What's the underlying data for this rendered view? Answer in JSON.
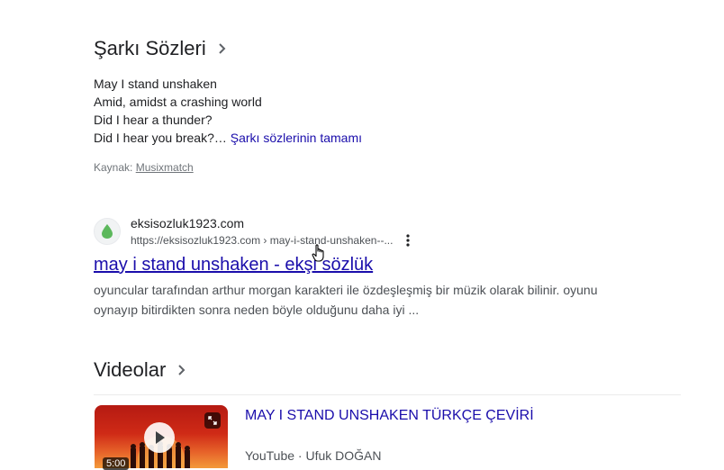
{
  "lyrics_section": {
    "title": "Şarkı Sözleri",
    "lines": [
      "May I stand unshaken",
      "Amid, amidst a crashing world",
      "Did I hear a thunder?",
      "Did I hear you break?…"
    ],
    "full_lyrics_link": "Şarkı sözlerinin tamamı",
    "source_label": "Kaynak:",
    "source_name": "Musixmatch"
  },
  "result": {
    "site_name": "eksisozluk1923.com",
    "url": "https://eksisozluk1923.com › may-i-stand-unshaken--...",
    "title": "may i stand unshaken - ekşi sözlük",
    "snippet_line1": "oyuncular tarafından arthur morgan karakteri ile özdeşleşmiş bir müzik olarak bilinir. oyunu",
    "snippet_line2": "oynayıp bitirdikten sonra neden böyle olduğunu daha iyi ...",
    "favicon_color": "#5cb85c"
  },
  "videos_section": {
    "title": "Videolar",
    "video": {
      "title": "MAY I STAND UNSHAKEN TÜRKÇE ÇEVİRİ",
      "platform": "YouTube",
      "separator": "·",
      "channel": "Ufuk DOĞAN",
      "duration": "5:00"
    }
  },
  "icons": [
    "chevron-right-icon",
    "drop-favicon-icon",
    "more-vert-icon",
    "play-icon",
    "expand-icon",
    "hand-cursor-icon"
  ]
}
